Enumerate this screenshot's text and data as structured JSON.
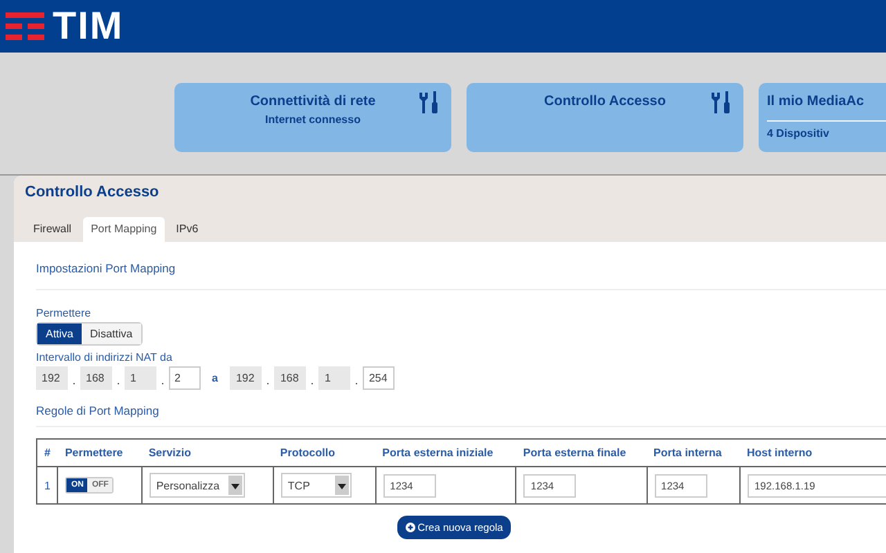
{
  "header": {
    "logo": "TIM"
  },
  "tiles": [
    {
      "title": "Connettività di rete",
      "subtitle": "Internet connesso",
      "tools": true,
      "divider": false
    },
    {
      "title": "Controllo Accesso",
      "tools": true,
      "divider": false
    },
    {
      "title": "Il mio MediaAc",
      "subtitle": "4 Dispositiv",
      "tools": false,
      "divider": true
    }
  ],
  "panel": {
    "title": "Controllo Accesso",
    "tabs": [
      {
        "label": "Firewall",
        "selected": false
      },
      {
        "label": "Port Mapping",
        "selected": true
      },
      {
        "label": "IPv6",
        "selected": false
      }
    ],
    "section_title": "Impostazioni Port Mapping",
    "permit_label": "Permettere",
    "permit_options": [
      {
        "label": "Attiva",
        "selected": true
      },
      {
        "label": "Disattiva",
        "selected": false
      }
    ],
    "range_label": "Intervallo di indirizzi NAT da",
    "range_from": [
      {
        "value": "192",
        "disabled": true
      },
      {
        "value": "168",
        "disabled": true
      },
      {
        "value": "1",
        "disabled": true
      },
      {
        "value": "2",
        "disabled": false
      }
    ],
    "range_sep": "a",
    "range_to": [
      {
        "value": "192",
        "disabled": true
      },
      {
        "value": "168",
        "disabled": true
      },
      {
        "value": "1",
        "disabled": true
      },
      {
        "value": "254",
        "disabled": false
      }
    ],
    "rules_title": "Regole di Port Mapping",
    "table": {
      "columns": [
        "#",
        "Permettere",
        "Servizio",
        "Protocollo",
        "Porta esterna iniziale",
        "Porta esterna finale",
        "Porta interna",
        "Host interno"
      ],
      "rows": [
        {
          "index": "1",
          "on": true,
          "on_label": "ON",
          "off_label": "OFF",
          "service": "Personalizza",
          "protocol": "TCP",
          "ext_start": "1234",
          "ext_end": "1234",
          "internal": "1234",
          "host": "192.168.1.19"
        }
      ]
    },
    "add_button": "Crea nuova regola"
  }
}
